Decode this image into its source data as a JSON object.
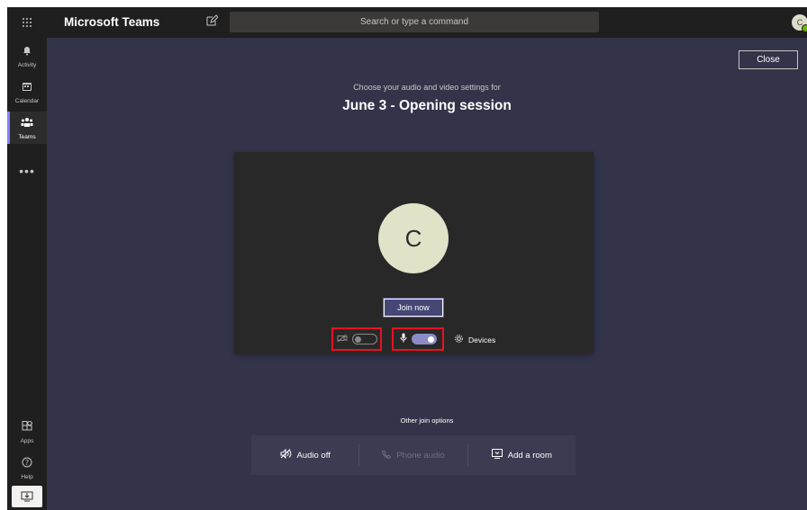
{
  "app": {
    "title": "Microsoft Teams"
  },
  "search": {
    "placeholder": "Search or type a command"
  },
  "user": {
    "initial": "C"
  },
  "rail": {
    "items": [
      {
        "label": "Activity",
        "icon": "bell-icon"
      },
      {
        "label": "Calendar",
        "icon": "calendar-icon"
      },
      {
        "label": "Teams",
        "icon": "teams-icon",
        "active": true
      }
    ],
    "more": "•••",
    "bottom": [
      {
        "label": "Apps",
        "icon": "apps-icon"
      },
      {
        "label": "Help",
        "icon": "help-icon"
      }
    ],
    "download_icon": "download-app-icon"
  },
  "meeting": {
    "close_label": "Close",
    "subtitle": "Choose your audio and video settings for",
    "title": "June 3 - Opening session",
    "avatar_initial": "C",
    "join_label": "Join now",
    "camera_on": false,
    "mic_on": true,
    "devices_label": "Devices",
    "other_options_label": "Other join options",
    "options": [
      {
        "label": "Audio off",
        "icon": "speaker-off-icon",
        "enabled": true
      },
      {
        "label": "Phone audio",
        "icon": "phone-icon",
        "enabled": false
      },
      {
        "label": "Add a room",
        "icon": "cast-icon",
        "enabled": true
      }
    ]
  },
  "colors": {
    "accent": "#6264a7",
    "toggle_on": "#8b8cc7",
    "highlight": "#e81123",
    "background": "#33344a"
  }
}
